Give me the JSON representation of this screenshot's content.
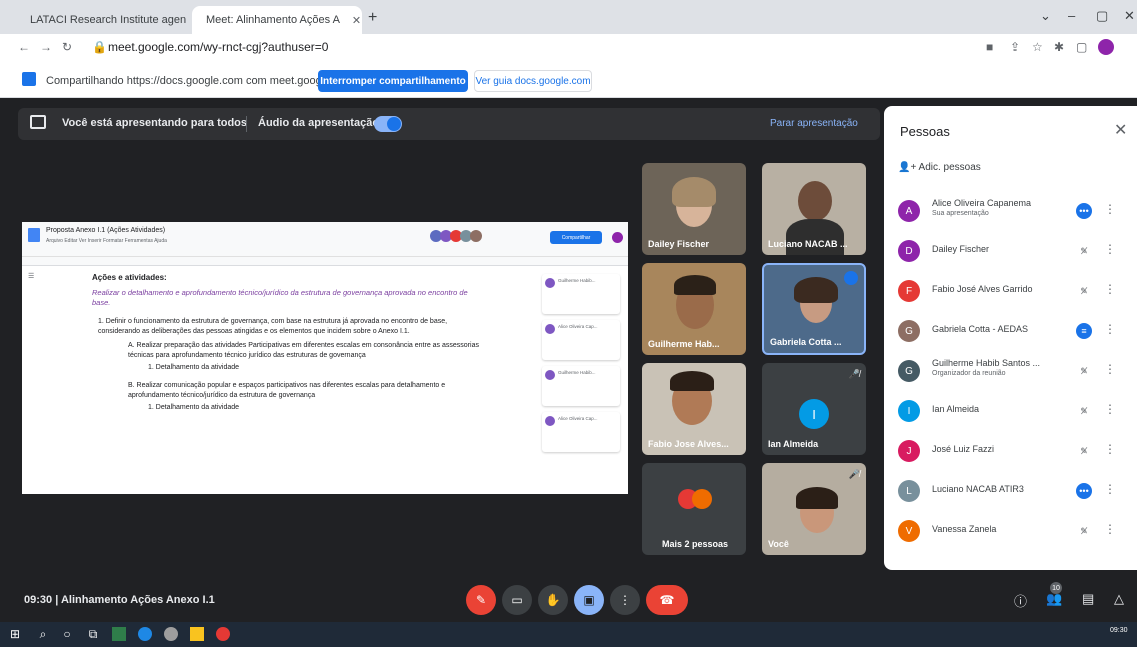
{
  "browser": {
    "tabs": [
      {
        "label": "LATACI Research Institute agen",
        "active": false
      },
      {
        "label": "Meet: Alinhamento Ações A",
        "active": true
      }
    ],
    "address": "meet.google.com/wy-rnct-cgj?authuser=0"
  },
  "share_notice": {
    "text": "Compartilhando https://docs.google.com com meet.google.com",
    "stop_button": "Interromper compartilhamento",
    "goto_button": "Ver guia docs.google.com"
  },
  "presentation_bar": {
    "status": "Você está apresentando para todos",
    "audio_label": "Áudio da apresentação",
    "stop_label": "Parar apresentação"
  },
  "document": {
    "title": "Proposta Anexo I.1 (Ações Atividades)",
    "menu": "Arquivo Editar Ver Inserir Formatar Ferramentas Ajuda",
    "share": "Compartilhar",
    "heading": "Ações e atividades:",
    "italic": "Realizar o detalhamento e aprofundamento técnico/jurídico da estrutura de governança aprovada no encontro de base.",
    "p1": "1. Definir o funcionamento da estrutura de governança, com base na estrutura já aprovada no encontro de base, considerando as deliberações das pessoas atingidas e os elementos que incidem sobre o Anexo I.1.",
    "a": "A. Realizar preparação das atividades Participativas em diferentes escalas em consonância entre as assessorias técnicas para aprofundamento técnico jurídico das estruturas de governança",
    "a1": "1. Detalhamento da atividade",
    "b": "B. Realizar comunicação popular e espaços participativos nas diferentes escalas para detalhamento e aprofundamento técnico/jurídico da estrutura de governança",
    "b1": "1. Detalhamento da atividade",
    "comments": [
      "Guilherme Habib...",
      "Alice Oliveira Cap...",
      "Guilherme Habib...",
      "Alice Oliveira Cap..."
    ]
  },
  "tiles": [
    {
      "name": "Dailey Fischer"
    },
    {
      "name": "Luciano NACAB ..."
    },
    {
      "name": "Guilherme Hab..."
    },
    {
      "name": "Gabriela Cotta ..."
    },
    {
      "name": "Fabio Jose Alves..."
    },
    {
      "name": "Ian Almeida",
      "initial": "I"
    },
    {
      "name": "Mais 2 pessoas"
    },
    {
      "name": "Você"
    }
  ],
  "people_panel": {
    "title": "Pessoas",
    "add": "Adic. pessoas",
    "people": [
      {
        "name": "Alice Oliveira Capanema",
        "sub": "Sua apresentação",
        "initial": "A",
        "color": "#8e24aa"
      },
      {
        "name": "Dailey Fischer",
        "sub": "",
        "initial": "D",
        "color": "#8e24aa"
      },
      {
        "name": "Fabio José Alves Garrido",
        "sub": "",
        "initial": "F",
        "color": "#e53935"
      },
      {
        "name": "Gabriela Cotta - AEDAS",
        "sub": "",
        "initial": "G",
        "color": "#8d6e63"
      },
      {
        "name": "Guilherme Habib Santos ...",
        "sub": "Organizador da reunião",
        "initial": "G",
        "color": "#455a64"
      },
      {
        "name": "Ian Almeida",
        "sub": "",
        "initial": "I",
        "color": "#039be5"
      },
      {
        "name": "José Luiz Fazzi",
        "sub": "",
        "initial": "J",
        "color": "#d81b60"
      },
      {
        "name": "Luciano NACAB ATIR3",
        "sub": "",
        "initial": "L",
        "color": "#78909c"
      },
      {
        "name": "Vanessa Zanela",
        "sub": "",
        "initial": "V",
        "color": "#ef6c00"
      }
    ]
  },
  "bottom": {
    "time": "09:30",
    "meeting": "Alinhamento Ações Anexo I.1",
    "participants_count": "10"
  },
  "taskbar": {
    "clock": "09:30"
  }
}
